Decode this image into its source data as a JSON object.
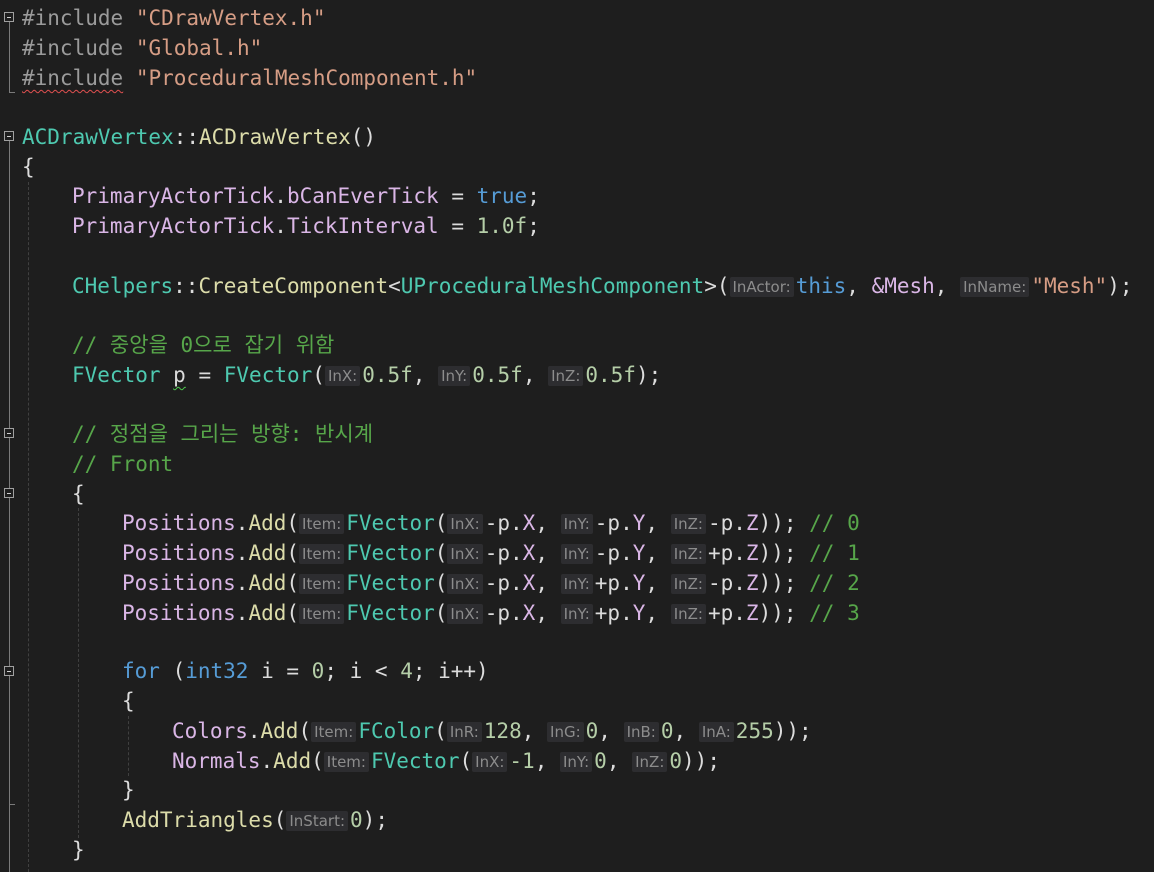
{
  "editor": {
    "includes": [
      {
        "directive": "#include",
        "file": "\"CDrawVertex.h\""
      },
      {
        "directive": "#include",
        "file": "\"Global.h\""
      },
      {
        "directive": "#include",
        "file": "\"ProceduralMeshComponent.h\""
      }
    ],
    "ctor": {
      "cls": "ACDrawVertex",
      "sep": "::",
      "name": "ACDrawVertex",
      "parens": "()"
    },
    "open_brace": "{",
    "tick1": {
      "obj": "PrimaryActorTick",
      "member": "bCanEverTick",
      "op": " = ",
      "val": "true",
      "end": ";"
    },
    "tick2": {
      "obj": "PrimaryActorTick",
      "member": "TickInterval",
      "op": " = ",
      "val": "1.0f",
      "end": ";"
    },
    "create": {
      "cls": "CHelpers",
      "sep": "::",
      "fn": "CreateComponent",
      "lt": "<",
      "tmpl": "UProceduralMeshComponent",
      "gt": ">(",
      "hint1": "InActor:",
      "arg1": "this",
      "comma1": ", ",
      "arg2": "&Mesh",
      "comma2": ", ",
      "hint2": "InName:",
      "arg3": "\"Mesh\"",
      "end": ");"
    },
    "comment_center": "// 중앙을 0으로 잡기 위함",
    "fvector_p": {
      "type": "FVector",
      "var": "p",
      "eq": " = ",
      "fn": "FVector",
      "open": "(",
      "hx": "InX:",
      "vx": "0.5f",
      "c1": ", ",
      "hy": "InY:",
      "vy": "0.5f",
      "c2": ", ",
      "hz": "InZ:",
      "vz": "0.5f",
      "end": ");"
    },
    "comment_dir": "// 정점을 그리는 방향: 반시계",
    "comment_front": "// Front",
    "block_open": "{",
    "positions": [
      {
        "sx": "-",
        "sy": "-",
        "sz": "-",
        "cmt": "// 0"
      },
      {
        "sx": "-",
        "sy": "-",
        "sz": "+",
        "cmt": "// 1"
      },
      {
        "sx": "-",
        "sy": "+",
        "sz": "-",
        "cmt": "// 2"
      },
      {
        "sx": "-",
        "sy": "+",
        "sz": "+",
        "cmt": "// 3"
      }
    ],
    "pos_labels": {
      "obj": "Positions",
      "fn": "Add",
      "hint_item": "Item:",
      "ctor": "FVector",
      "hx": "InX:",
      "hy": "InY:",
      "hz": "InZ:",
      "px": "p.X",
      "py": "p.Y",
      "pz": "p.Z"
    },
    "for_line": {
      "kw": "for",
      "open": " (",
      "type": "int32",
      "rest": " i = ",
      "zero": "0",
      "mid": "; i < ",
      "four": "4",
      "end": "; i++)"
    },
    "inner_open": "{",
    "colors": {
      "obj": "Colors",
      "fn": "Add",
      "hint_item": "Item:",
      "ctor": "FColor",
      "hr": "InR:",
      "vr": "128",
      "hg": "InG:",
      "vg": "0",
      "hb": "InB:",
      "vb": "0",
      "ha": "InA:",
      "va": "255",
      "end": "));"
    },
    "normals": {
      "obj": "Normals",
      "fn": "Add",
      "hint_item": "Item:",
      "ctor": "FVector",
      "hx": "InX:",
      "vx": "-1",
      "hy": "InY:",
      "vy": "0",
      "hz": "InZ:",
      "vz": "0",
      "end": "));"
    },
    "inner_close": "}",
    "add_tri": {
      "fn": "AddTriangles",
      "hint": "InStart:",
      "val": "0",
      "end": ");"
    },
    "block_close": "}"
  }
}
